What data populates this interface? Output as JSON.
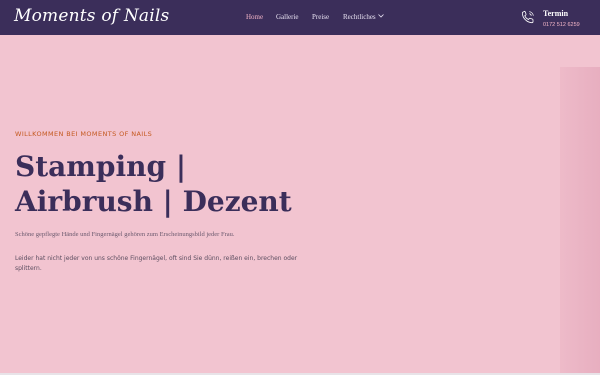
{
  "brand": {
    "logo_text": "Moments of Nails"
  },
  "nav": {
    "items": [
      {
        "label": "Home"
      },
      {
        "label": "Gallerie"
      },
      {
        "label": "Preise"
      },
      {
        "label": "Rechtliches"
      }
    ],
    "active": "Home"
  },
  "contact": {
    "title": "Termin",
    "phone": "0172 512 6259",
    "icon": "phone-icon"
  },
  "hero": {
    "eyebrow": "WILLKOMMEN BEI MOMENTS OF NAILS",
    "headline_line1": "Stamping |",
    "headline_line2": "Airbrush | Dezent",
    "intro_serif": "Schöne gepflegte Hände und Fingernägel gehören zum Erscheinungsbild jeder Frau.",
    "intro_sans": "Leider hat nicht jeder von uns schöne Fingernägel, oft sind Sie dünn, reißen ein, brechen oder splittern."
  },
  "colors": {
    "header_bg": "#3b2e5a",
    "hero_bg": "#f2c4d0",
    "accent_orange": "#c4591f",
    "headline": "#3b2e5a",
    "pink_accent": "#f4b6c8"
  }
}
